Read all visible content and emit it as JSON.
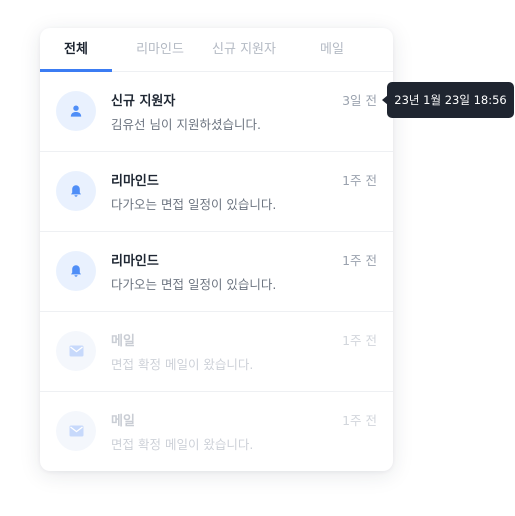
{
  "tabs": [
    {
      "label": "전체",
      "active": true
    },
    {
      "label": "리마인드",
      "active": false
    },
    {
      "label": "신규 지원자",
      "active": false
    },
    {
      "label": "메일",
      "active": false
    }
  ],
  "notifications": [
    {
      "icon": "person-icon",
      "title": "신규 지원자",
      "time": "3일 전",
      "message": "김유선 님이 지원하셨습니다.",
      "dimmed": false
    },
    {
      "icon": "bell-icon",
      "title": "리마인드",
      "time": "1주 전",
      "message": "다가오는 면접 일정이 있습니다.",
      "dimmed": false
    },
    {
      "icon": "bell-icon",
      "title": "리마인드",
      "time": "1주 전",
      "message": "다가오는 면접 일정이 있습니다.",
      "dimmed": false
    },
    {
      "icon": "mail-icon",
      "title": "메일",
      "time": "1주 전",
      "message": "면접 확정 메일이 왔습니다.",
      "dimmed": true
    },
    {
      "icon": "mail-icon",
      "title": "메일",
      "time": "1주 전",
      "message": "면접 확정 메일이 왔습니다.",
      "dimmed": true
    }
  ],
  "tooltip": {
    "text": "23년 1월 23일 18:56"
  },
  "colors": {
    "accent": "#3b7cf3",
    "icon": "#4f8ef7",
    "icon_dim": "#c7d9fb",
    "tooltip_bg": "#1f2530"
  }
}
